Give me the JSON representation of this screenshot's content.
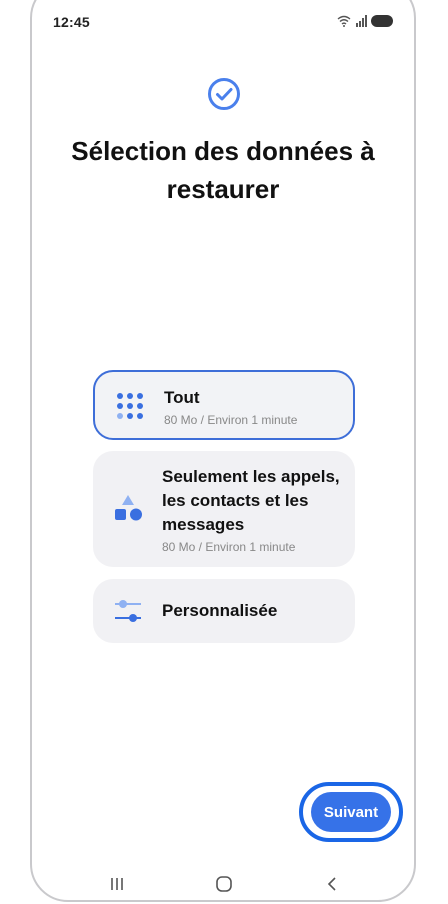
{
  "status_bar": {
    "time": "12:45",
    "icons": [
      "wifi-icon",
      "signal-icon",
      "battery-icon"
    ]
  },
  "header": {
    "title": "Sélection des données à restaurer",
    "icon": "check-circle-icon"
  },
  "options": [
    {
      "title": "Tout",
      "subtitle": "80 Mo / Environ 1 minute",
      "icon": "grid-dots-icon",
      "selected": true
    },
    {
      "title": "Seulement les appels, les contacts et les messages",
      "subtitle": "80 Mo / Environ 1 minute",
      "icon": "shapes-icon",
      "selected": false
    },
    {
      "title": "Personnalisée",
      "icon": "sliders-icon",
      "selected": false
    }
  ],
  "footer": {
    "next_label": "Suivant"
  },
  "nav_bar": {
    "items": [
      "recents-icon",
      "home-icon",
      "back-icon"
    ]
  },
  "colors": {
    "accent": "#3672e8",
    "highlight_ring": "#1a66e6",
    "card_bg": "#f1f1f4"
  }
}
